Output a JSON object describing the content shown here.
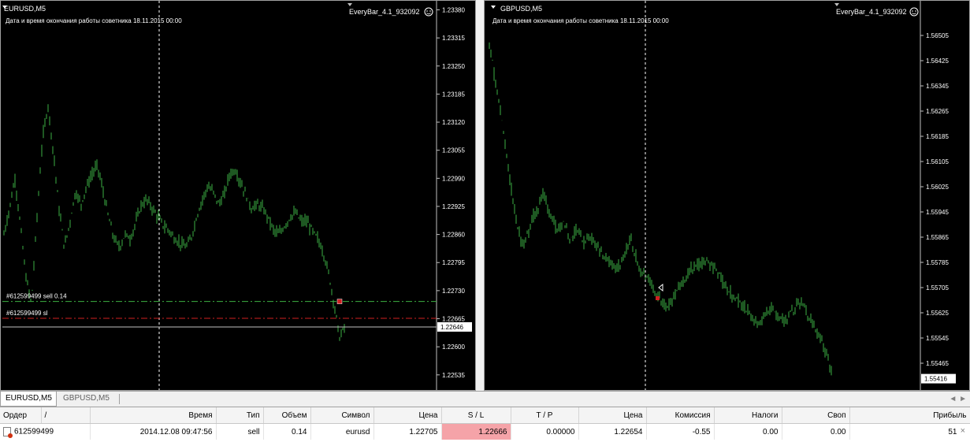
{
  "charts": [
    {
      "title": "EURUSD,M5",
      "expert_name": "EveryBar_4.1_932092",
      "info_line": "Дата и время окончания работы советника 18.11.2015 00:00",
      "price_labels": [
        "1.23380",
        "1.23315",
        "1.23250",
        "1.23185",
        "1.23120",
        "1.23055",
        "1.22990",
        "1.22925",
        "1.22860",
        "1.22795",
        "1.22730",
        "1.22665",
        "1.22600",
        "1.22535"
      ],
      "price_range": [
        1.225,
        1.2339
      ],
      "current_price": "1.22646",
      "order_lines": [
        {
          "label": "#612599499 sell 0.14",
          "price": 1.22705,
          "color": "#3cb043"
        },
        {
          "label": "#612599499 sl",
          "price": 1.22666,
          "color": "#d02020"
        }
      ],
      "bid_line_price": 1.22646,
      "series": [
        1.2286,
        1.2292,
        1.2299,
        1.2288,
        1.2276,
        1.227,
        1.229,
        1.2308,
        1.2316,
        1.2305,
        1.2292,
        1.2283,
        1.2289,
        1.2296,
        1.2293,
        1.2297,
        1.23,
        1.2302,
        1.2296,
        1.229,
        1.2285,
        1.2283,
        1.2286,
        1.2285,
        1.2289,
        1.2293,
        1.2294,
        1.2292,
        1.229,
        1.2288,
        1.2287,
        1.2285,
        1.2284,
        1.2283,
        1.2285,
        1.229,
        1.2294,
        1.2297,
        1.2296,
        1.2293,
        1.2295,
        1.23,
        1.2301,
        1.2298,
        1.2295,
        1.2292,
        1.2293,
        1.2292,
        1.229,
        1.2287,
        1.2286,
        1.2288,
        1.229,
        1.2291,
        1.2289,
        1.2289,
        1.2287,
        1.2285,
        1.2282,
        1.2277,
        1.227,
        1.2262,
        1.2265
      ]
    },
    {
      "title": "GBPUSD,M5",
      "expert_name": "EveryBar_4.1_932092",
      "info_line": "Дата и время окончания работы советника 18.11.2015 00:00",
      "price_labels": [
        "1.56505",
        "1.56425",
        "1.56345",
        "1.56265",
        "1.56185",
        "1.56105",
        "1.56025",
        "1.55945",
        "1.55865",
        "1.55785",
        "1.55705",
        "1.55625",
        "1.55545",
        "1.55465"
      ],
      "price_range": [
        1.5538,
        1.566
      ],
      "current_price": "1.55416",
      "series": [
        1.5648,
        1.5635,
        1.5622,
        1.5605,
        1.5592,
        1.5583,
        1.559,
        1.5595,
        1.56,
        1.5594,
        1.5588,
        1.5592,
        1.5586,
        1.5589,
        1.5585,
        1.5587,
        1.5583,
        1.558,
        1.5578,
        1.5576,
        1.558,
        1.5586,
        1.5578,
        1.5575,
        1.5572,
        1.5568,
        1.5564,
        1.5566,
        1.557,
        1.5573,
        1.5576,
        1.5578,
        1.5579,
        1.5578,
        1.5575,
        1.5571,
        1.5568,
        1.5566,
        1.5564,
        1.5561,
        1.5559,
        1.5562,
        1.5564,
        1.5561,
        1.556,
        1.5563,
        1.5566,
        1.5563,
        1.5559,
        1.5555,
        1.5549,
        1.5542
      ]
    }
  ],
  "tabs": [
    {
      "label": "EURUSD,M5",
      "active": true
    },
    {
      "label": "GBPUSD,M5",
      "active": false
    }
  ],
  "tab_scroll": "◄ ►",
  "orders_table": {
    "columns": [
      "Ордер",
      "/",
      "Время",
      "Тип",
      "Объем",
      "Символ",
      "Цена",
      "S / L",
      "T / P",
      "Цена",
      "Комиссия",
      "Налоги",
      "Своп",
      "Прибыль"
    ],
    "rows": [
      [
        "612599499",
        "2014.12.08 09:47:56",
        "sell",
        "0.14",
        "eurusd",
        "1.22705",
        "1.22666",
        "0.00000",
        "1.22654",
        "-0.55",
        "0.00",
        "0.00",
        "51"
      ]
    ]
  },
  "colors": {
    "candle": "#3cb043",
    "grid_vline": "#ffffff",
    "sl_highlight": "#f5a3a8"
  },
  "close_glyph": "×"
}
